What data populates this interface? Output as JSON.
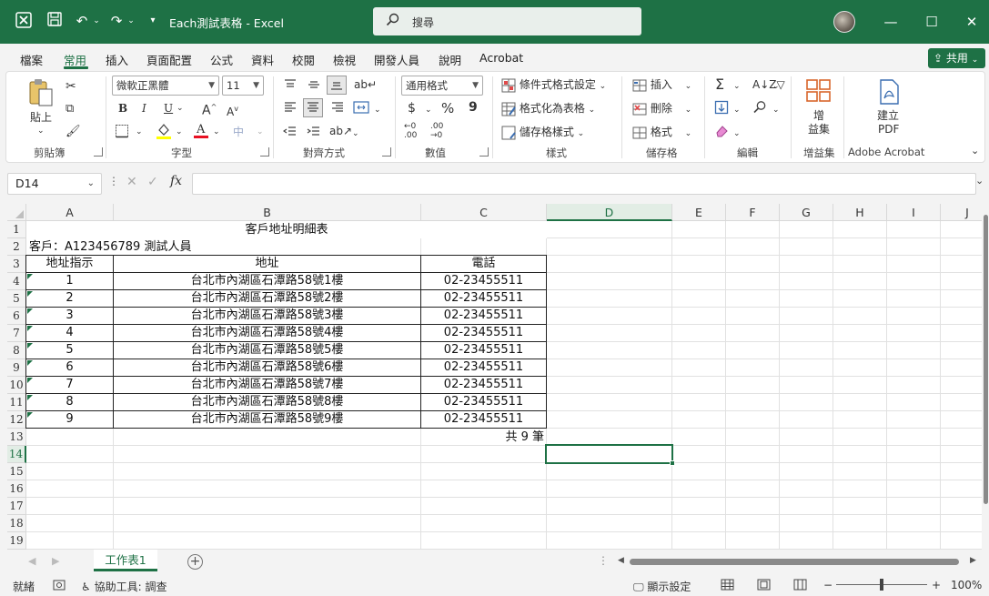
{
  "titlebar": {
    "title": "Each測試表格  -  Excel",
    "search_placeholder": "搜尋",
    "icons": [
      "excel-logo-icon",
      "save-icon",
      "undo-icon",
      "redo-icon",
      "customize-qat-icon",
      "minimize-icon",
      "maximize-icon",
      "close-icon"
    ],
    "accent_color": "#1e7145"
  },
  "tabs": [
    "檔案",
    "常用",
    "插入",
    "頁面配置",
    "公式",
    "資料",
    "校閱",
    "檢視",
    "開發人員",
    "說明",
    "Acrobat"
  ],
  "active_tab": "常用",
  "share_label": "共用",
  "ribbon": {
    "clipboard": {
      "paste": "貼上",
      "label": "剪貼簿"
    },
    "font": {
      "name": "微軟正黑體",
      "size": "11",
      "bold": "B",
      "italic": "I",
      "underline": "U",
      "grow": "A",
      "shrink": "A",
      "label": "字型"
    },
    "alignment": {
      "label": "對齊方式"
    },
    "number": {
      "format": "通用格式",
      "currency": "$",
      "percent": "%",
      "comma": "9",
      "label": "數值"
    },
    "styles": {
      "conditional": "條件式格式設定",
      "as_table": "格式化為表格",
      "cell_styles": "儲存格樣式",
      "label": "樣式"
    },
    "cells": {
      "insert": "插入",
      "delete": "刪除",
      "format": "格式",
      "label": "儲存格"
    },
    "editing": {
      "label": "編輯"
    },
    "addins": {
      "button_line1": "增",
      "button_line2": "益集",
      "label": "增益集"
    },
    "acrobat": {
      "button_line1": "建立",
      "button_line2": "PDF",
      "label": "Adobe Acrobat"
    }
  },
  "formula_bar": {
    "name_box": "D14",
    "fx": "fx",
    "value": ""
  },
  "columns": [
    "A",
    "B",
    "C",
    "D",
    "E",
    "F",
    "G",
    "H",
    "I",
    "J"
  ],
  "rows": [
    "1",
    "2",
    "3",
    "4",
    "5",
    "6",
    "7",
    "8",
    "9",
    "10",
    "11",
    "12",
    "13",
    "14",
    "15",
    "16",
    "17",
    "18",
    "19"
  ],
  "selected_cell": {
    "col": "D",
    "row": "14"
  },
  "sheet": {
    "title": "客戶地址明細表",
    "customer": "客戶：A123456789 測試人員",
    "headers": [
      "地址指示",
      "地址",
      "電話"
    ],
    "records": [
      [
        "1",
        "台北市內湖區石潭路58號1樓",
        "02-23455511"
      ],
      [
        "2",
        "台北市內湖區石潭路58號2樓",
        "02-23455511"
      ],
      [
        "3",
        "台北市內湖區石潭路58號3樓",
        "02-23455511"
      ],
      [
        "4",
        "台北市內湖區石潭路58號4樓",
        "02-23455511"
      ],
      [
        "5",
        "台北市內湖區石潭路58號5樓",
        "02-23455511"
      ],
      [
        "6",
        "台北市內湖區石潭路58號6樓",
        "02-23455511"
      ],
      [
        "7",
        "台北市內湖區石潭路58號7樓",
        "02-23455511"
      ],
      [
        "8",
        "台北市內湖區石潭路58號8樓",
        "02-23455511"
      ],
      [
        "9",
        "台北市內湖區石潭路58號9樓",
        "02-23455511"
      ]
    ],
    "total": "共 9 筆"
  },
  "sheet_tabs": [
    "工作表1"
  ],
  "status": {
    "ready": "就緒",
    "accessibility": "協助工具: 調查",
    "display_settings": "顯示設定",
    "zoom_out": "−",
    "zoom_in": "+",
    "zoom": "100%"
  }
}
